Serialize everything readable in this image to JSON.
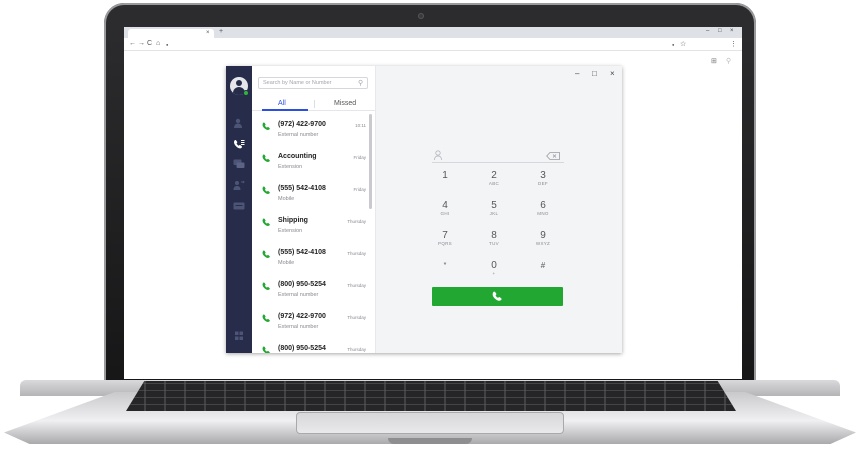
{
  "colors": {
    "rail_bg": "#262c4a",
    "accent_blue": "#2d4fe0",
    "call_green": "#22a832",
    "presence_green": "#2db63c",
    "dialer_bg": "#f3f4f6"
  },
  "browser": {
    "tab_close": "×",
    "new_tab": "+",
    "win_min": "–",
    "win_max": "□",
    "win_close": "×",
    "nav_icons": [
      "back-icon",
      "forward-icon",
      "reload-icon",
      "home-icon",
      "lock-icon"
    ],
    "nav_glyphs": {
      "back": "←",
      "forward": "→",
      "reload": "C",
      "home": "⌂",
      "lock": "●"
    },
    "right_icons": {
      "location": "●",
      "star": "☆",
      "menu": "⋮"
    },
    "extensions": {
      "apps": "⊞",
      "profile": "⚲"
    }
  },
  "sidebar": {
    "icons": [
      "contacts-icon",
      "call-history-icon",
      "chat-icon",
      "transfer-icon",
      "voicemail-icon",
      "apps-grid-icon"
    ]
  },
  "search": {
    "placeholder": "Search by Name or Number",
    "icon": "search-icon",
    "icon_glyph": "⚲"
  },
  "tabs": {
    "all": "All",
    "missed": "Missed"
  },
  "calls": [
    {
      "number": "(972) 422-9700",
      "type": "External number",
      "when": "10:11"
    },
    {
      "number": "Accounting",
      "type": "Extension",
      "when": "Friday"
    },
    {
      "number": "(555) 542-4108",
      "type": "Mobile",
      "when": "Friday"
    },
    {
      "number": "Shipping",
      "type": "Extension",
      "when": "Thursday"
    },
    {
      "number": "(555) 542-4108",
      "type": "Mobile",
      "when": "Thursday"
    },
    {
      "number": "(800) 950-5254",
      "type": "External number",
      "when": "Thursday"
    },
    {
      "number": "(972) 422-9700",
      "type": "External number",
      "when": "Thursday"
    },
    {
      "number": "(800) 950-5254",
      "type": "",
      "when": "Thursday"
    }
  ],
  "window": {
    "minimize": "–",
    "maximize": "□",
    "close": "×"
  },
  "dialpad": {
    "keys": [
      {
        "digit": "1",
        "letters": ""
      },
      {
        "digit": "2",
        "letters": "ABC"
      },
      {
        "digit": "3",
        "letters": "DEF"
      },
      {
        "digit": "4",
        "letters": "GHI"
      },
      {
        "digit": "5",
        "letters": "JKL"
      },
      {
        "digit": "6",
        "letters": "MNO"
      },
      {
        "digit": "7",
        "letters": "PQRS"
      },
      {
        "digit": "8",
        "letters": "TUV"
      },
      {
        "digit": "9",
        "letters": "WXYZ"
      },
      {
        "digit": "*",
        "letters": ""
      },
      {
        "digit": "0",
        "letters": "+"
      },
      {
        "digit": "#",
        "letters": ""
      }
    ]
  }
}
